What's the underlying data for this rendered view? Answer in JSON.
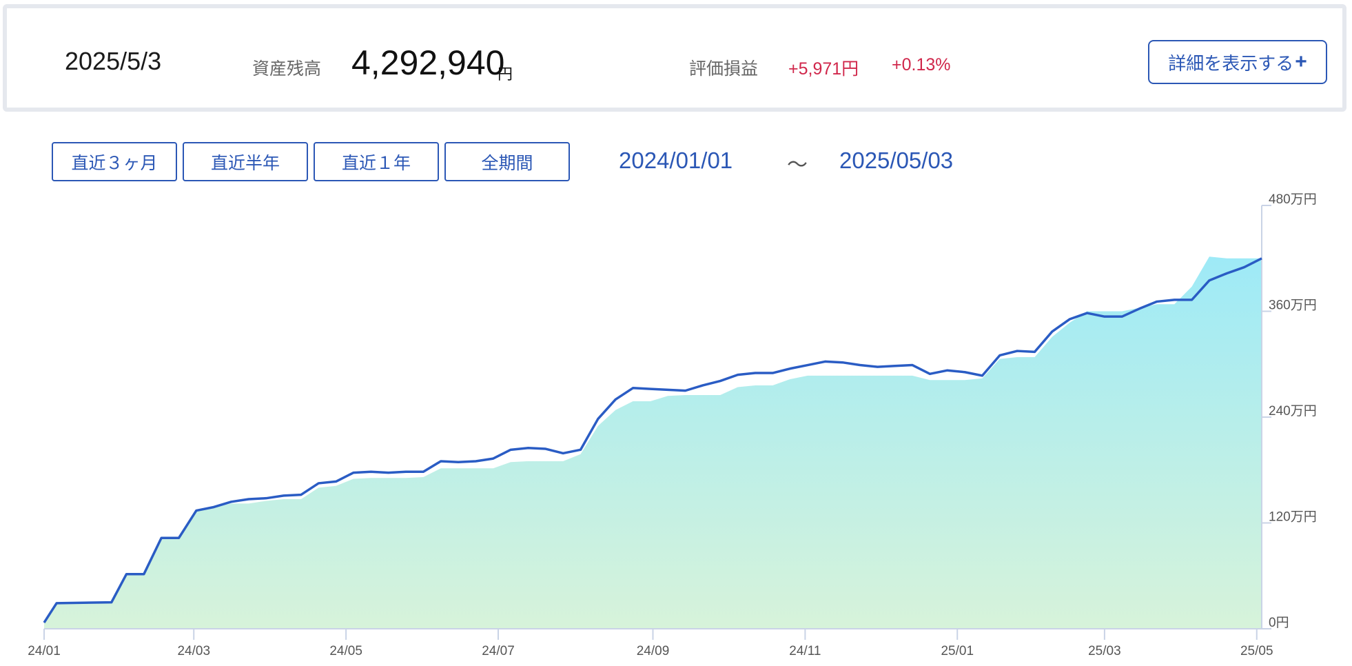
{
  "summary": {
    "date": "2025/5/3",
    "asset_label": "資産残高",
    "asset_value": "4,292,940",
    "asset_unit": "円",
    "pl_label": "評価損益",
    "pl_amount": "+5,971円",
    "pl_percent": "+0.13%",
    "detail_button_label": "詳細を表示する",
    "detail_button_icon": "plus-icon"
  },
  "range_buttons": [
    "直近３ヶ月",
    "直近半年",
    "直近１年",
    "全期間"
  ],
  "date_range": {
    "start": "2024/01/01",
    "separator": "～",
    "end": "2025/05/03"
  },
  "colors": {
    "accent": "#2b57b5",
    "gain": "#d0274b",
    "line": "#2a5cc4",
    "area_top": "#9eeaf7",
    "area_bottom": "#d7f3da"
  },
  "chart_data": {
    "type": "area",
    "xlabel": "",
    "ylabel": "",
    "x_tick_labels": [
      "24/01",
      "24/03",
      "24/05",
      "24/07",
      "24/09",
      "24/11",
      "25/01",
      "25/03",
      "25/05"
    ],
    "x_ticks_day": [
      0,
      60,
      121,
      182,
      244,
      305,
      366,
      425,
      486
    ],
    "y_tick_labels": [
      "0円",
      "120万円",
      "240万円",
      "360万円",
      "480万円"
    ],
    "y_ticks": [
      0,
      120,
      240,
      360,
      480
    ],
    "ylim": [
      0,
      480
    ],
    "xlim_day": [
      0,
      488
    ],
    "unit": "万円",
    "series": [
      {
        "x_day": [
          0,
          5,
          27,
          33,
          40,
          47,
          54,
          61,
          68,
          75,
          82,
          89,
          96,
          103,
          110,
          117,
          124,
          131,
          138,
          145,
          152,
          159,
          166,
          173,
          180,
          187,
          194,
          201,
          208,
          215,
          222,
          229,
          236,
          243,
          250,
          257,
          264,
          271,
          278,
          285,
          292,
          299,
          306,
          313,
          320,
          327,
          334,
          341,
          348,
          355,
          362,
          369,
          376,
          383,
          390,
          397,
          404,
          411,
          418,
          425,
          432,
          439,
          446,
          453,
          460,
          467,
          474,
          481,
          488
        ],
        "values": [
          7,
          29,
          30,
          62,
          62,
          103,
          103,
          134,
          138,
          144,
          147,
          148,
          151,
          152,
          165,
          167,
          177,
          178,
          177,
          178,
          178,
          190,
          189,
          190,
          193,
          203,
          205,
          204,
          199,
          203,
          238,
          260,
          273,
          272,
          271,
          270,
          276,
          281,
          288,
          290,
          290,
          295,
          299,
          303,
          302,
          299,
          297,
          298,
          299,
          289,
          293,
          291,
          287,
          310,
          315,
          314,
          337,
          351,
          358,
          354,
          354,
          363,
          371,
          373,
          373,
          395,
          403,
          410,
          420
        ]
      },
      {
        "x_day": [
          0,
          5,
          27,
          33,
          40,
          47,
          54,
          61,
          68,
          75,
          82,
          89,
          96,
          103,
          110,
          117,
          124,
          131,
          138,
          145,
          152,
          159,
          166,
          173,
          180,
          187,
          194,
          201,
          208,
          215,
          222,
          229,
          236,
          243,
          250,
          257,
          264,
          271,
          278,
          285,
          292,
          299,
          306,
          313,
          320,
          327,
          334,
          341,
          348,
          355,
          362,
          369,
          376,
          383,
          390,
          397,
          404,
          411,
          418,
          425,
          432,
          439,
          446,
          453,
          460,
          467,
          474,
          481,
          488
        ],
        "values": [
          7,
          29,
          30,
          62,
          62,
          103,
          103,
          134,
          138,
          142,
          142,
          145,
          147,
          147,
          160,
          162,
          170,
          171,
          171,
          171,
          172,
          182,
          182,
          182,
          182,
          189,
          190,
          190,
          190,
          198,
          230,
          248,
          258,
          258,
          264,
          265,
          265,
          265,
          274,
          276,
          276,
          283,
          287,
          287,
          287,
          287,
          287,
          287,
          287,
          282,
          282,
          282,
          284,
          306,
          308,
          308,
          331,
          347,
          360,
          360,
          360,
          364,
          368,
          368,
          388,
          422,
          420,
          420,
          420
        ]
      }
    ]
  }
}
